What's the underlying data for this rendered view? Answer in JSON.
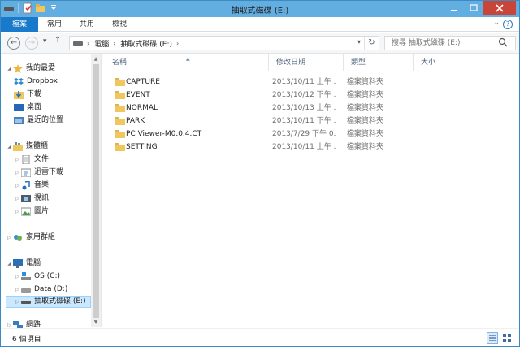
{
  "window": {
    "title": "抽取式磁碟 (E:)"
  },
  "ribbon": {
    "tabs": [
      "檔案",
      "常用",
      "共用",
      "檢視"
    ]
  },
  "address": {
    "crumbs": [
      "電腦",
      "抽取式磁碟 (E:)"
    ]
  },
  "search": {
    "placeholder": "搜尋 抽取式磁碟 (E:)"
  },
  "nav": {
    "favorites": {
      "label": "我的最愛",
      "items": [
        "Dropbox",
        "下載",
        "桌面",
        "最近的位置"
      ]
    },
    "libraries": {
      "label": "媒體櫃",
      "items": [
        "文件",
        "迅雷下載",
        "音樂",
        "視訊",
        "圖片"
      ]
    },
    "homegroup": {
      "label": "家用群組"
    },
    "computer": {
      "label": "電腦",
      "items": [
        "OS (C:)",
        "Data (D:)",
        "抽取式磁碟 (E:)"
      ]
    },
    "network": {
      "label": "網路"
    }
  },
  "columns": [
    "名稱",
    "修改日期",
    "類型",
    "大小"
  ],
  "files": [
    {
      "name": "CAPTURE",
      "date": "2013/10/11 上午 ...",
      "type": "檔案資料夾"
    },
    {
      "name": "EVENT",
      "date": "2013/10/12 下午 ...",
      "type": "檔案資料夾"
    },
    {
      "name": "NORMAL",
      "date": "2013/10/13 上午 ...",
      "type": "檔案資料夾"
    },
    {
      "name": "PARK",
      "date": "2013/10/11 下午 ...",
      "type": "檔案資料夾"
    },
    {
      "name": "PC Viewer-M0.0.4.CT",
      "date": "2013/7/29 下午 0...",
      "type": "檔案資料夾"
    },
    {
      "name": "SETTING",
      "date": "2013/10/11 上午 ...",
      "type": "檔案資料夾"
    }
  ],
  "status": {
    "count": "6 個項目"
  },
  "colors": {
    "titlebar": "#63aee0",
    "file_tab": "#1979ca",
    "folder": "#f0c75e",
    "selection": "#cce8ff",
    "close": "#c9453a"
  }
}
